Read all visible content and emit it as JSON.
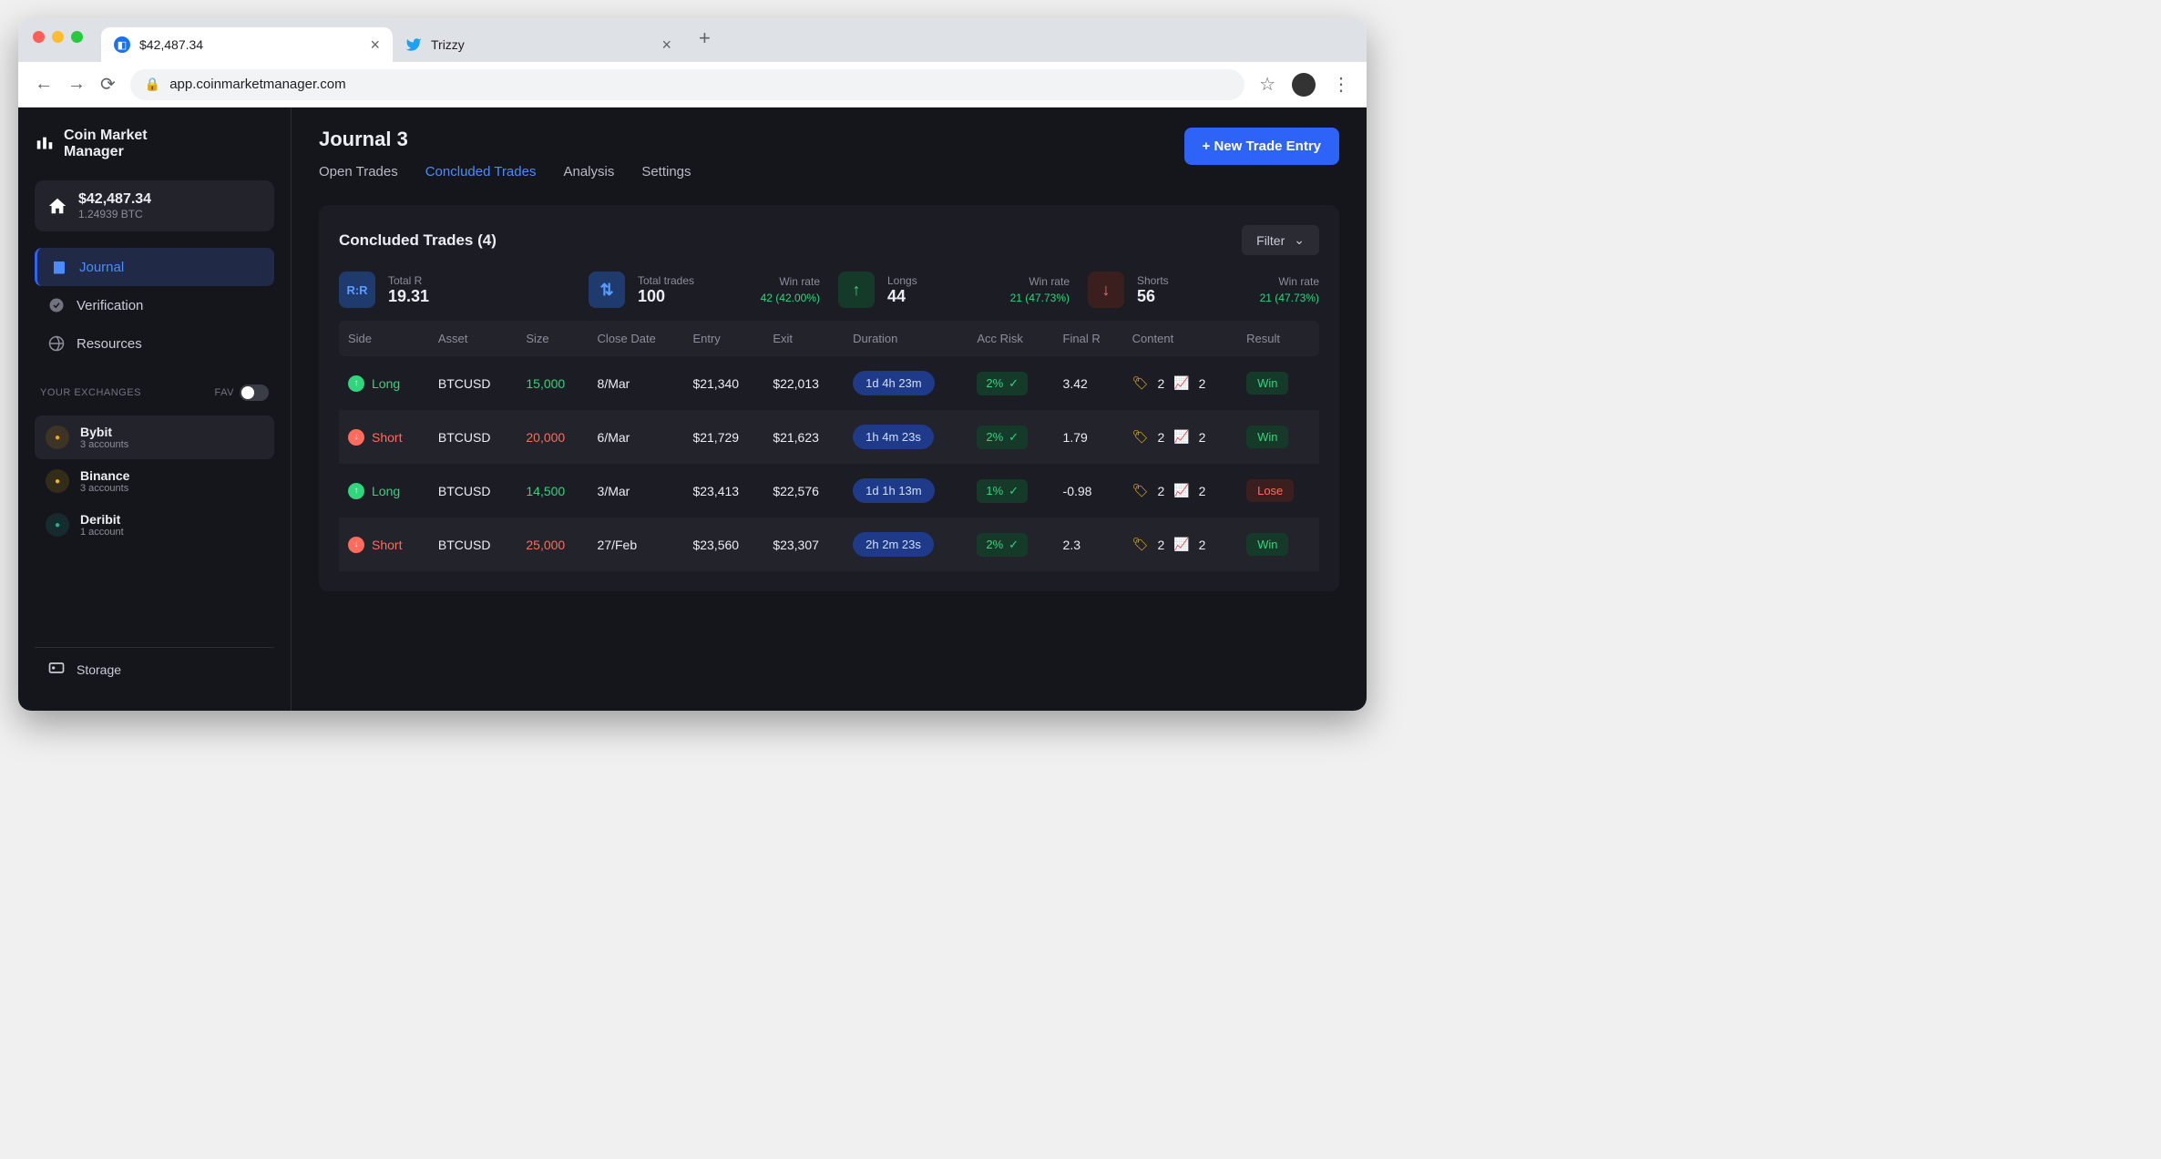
{
  "browser": {
    "tabs": [
      {
        "title": "$42,487.34",
        "icon_color": "#1a73e8"
      },
      {
        "title": "Trizzy",
        "icon_color": "#1da1f2"
      }
    ],
    "url": "app.coinmarketmanager.com"
  },
  "logo": {
    "line1": "Coin Market",
    "line2": "Manager"
  },
  "balance": {
    "amount": "$42,487.34",
    "sub": "1.24939 BTC"
  },
  "nav": [
    {
      "label": "Journal",
      "active": true
    },
    {
      "label": "Verification",
      "active": false
    },
    {
      "label": "Resources",
      "active": false
    }
  ],
  "exchanges_label": "YOUR EXCHANGES",
  "fav_label": "FAV",
  "exchanges": [
    {
      "name": "Bybit",
      "sub": "3 accounts",
      "color": "#f7a600",
      "active": true
    },
    {
      "name": "Binance",
      "sub": "3 accounts",
      "color": "#f0b90b",
      "active": false
    },
    {
      "name": "Deribit",
      "sub": "1 account",
      "color": "#17b79a",
      "active": false
    }
  ],
  "storage_label": "Storage",
  "page_title": "Journal 3",
  "new_button": "+ New Trade Entry",
  "main_tabs": [
    "Open Trades",
    "Concluded Trades",
    "Analysis",
    "Settings"
  ],
  "active_tab": "Concluded Trades",
  "panel_title": "Concluded Trades (4)",
  "filter_label": "Filter",
  "stats": {
    "total_r": {
      "label": "Total R",
      "value": "19.31"
    },
    "total_trades": {
      "label": "Total trades",
      "value": "100",
      "extra_label": "Win rate",
      "extra_value": "42 (42.00%)"
    },
    "longs": {
      "label": "Longs",
      "value": "44",
      "extra_label": "Win rate",
      "extra_value": "21 (47.73%)"
    },
    "shorts": {
      "label": "Shorts",
      "value": "56",
      "extra_label": "Win rate",
      "extra_value": "21 (47.73%)"
    }
  },
  "columns": [
    "Side",
    "Asset",
    "Size",
    "Close Date",
    "Entry",
    "Exit",
    "Duration",
    "Acc Risk",
    "Final R",
    "Content",
    "Result"
  ],
  "rows": [
    {
      "side": "Long",
      "asset": "BTCUSD",
      "size": "15,000",
      "close": "8/Mar",
      "entry": "$21,340",
      "exit": "$22,013",
      "dur": "1d 4h 23m",
      "risk": "2%",
      "r": "3.42",
      "tags": "2",
      "charts": "2",
      "result": "Win"
    },
    {
      "side": "Short",
      "asset": "BTCUSD",
      "size": "20,000",
      "close": "6/Mar",
      "entry": "$21,729",
      "exit": "$21,623",
      "dur": "1h 4m 23s",
      "risk": "2%",
      "r": "1.79",
      "tags": "2",
      "charts": "2",
      "result": "Win"
    },
    {
      "side": "Long",
      "asset": "BTCUSD",
      "size": "14,500",
      "close": "3/Mar",
      "entry": "$23,413",
      "exit": "$22,576",
      "dur": "1d 1h 13m",
      "risk": "1%",
      "r": "-0.98",
      "tags": "2",
      "charts": "2",
      "result": "Lose"
    },
    {
      "side": "Short",
      "asset": "BTCUSD",
      "size": "25,000",
      "close": "27/Feb",
      "entry": "$23,560",
      "exit": "$23,307",
      "dur": "2h 2m 23s",
      "risk": "2%",
      "r": "2.3",
      "tags": "2",
      "charts": "2",
      "result": "Win"
    }
  ]
}
